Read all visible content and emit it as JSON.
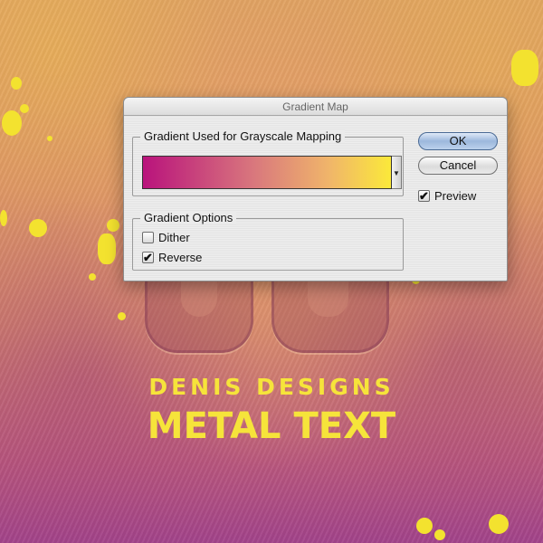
{
  "dialog": {
    "title": "Gradient Map",
    "gradient_group_label": "Gradient Used for Grayscale Mapping",
    "gradient_colors": [
      "#b9137c",
      "#d9787d",
      "#f0b56a",
      "#fbe93a"
    ],
    "options_group_label": "Gradient Options",
    "dither_label": "Dither",
    "dither_checked": false,
    "reverse_label": "Reverse",
    "reverse_checked": true,
    "ok_label": "OK",
    "cancel_label": "Cancel",
    "preview_label": "Preview",
    "preview_checked": true,
    "check_glyph": "✔",
    "dropdown_glyph": "▼"
  },
  "artwork": {
    "line1": "DENIS DESIGNS",
    "line2": "METAL TEXT",
    "text_color": "#f6e43a",
    "splatter_color": "#f3e22f"
  }
}
